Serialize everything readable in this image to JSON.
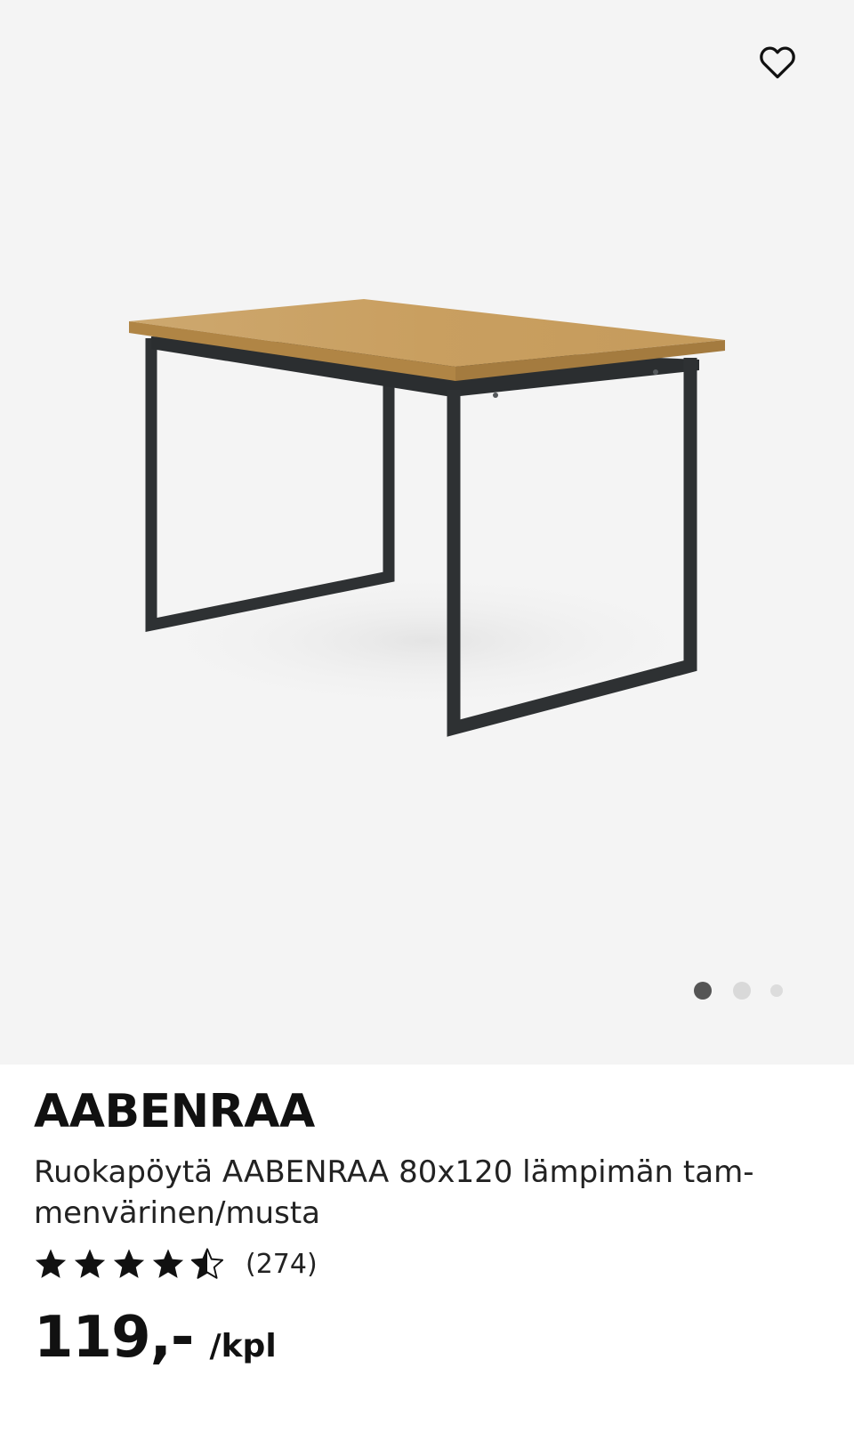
{
  "product": {
    "brand": "AABENRAA",
    "description": "Ruokapöytä AABENRAA 80x120 lämpimän tam-menvärinen/musta",
    "rating": {
      "value": 4.5,
      "max": 5,
      "count": "(274)"
    },
    "price": "119,-",
    "unit": "/kpl"
  },
  "gallery": {
    "image_subject": "dining-table",
    "current_index": 1,
    "total_images": 3
  },
  "icons": {
    "favorite": "heart-outline-icon",
    "star": "star-icon"
  },
  "colors": {
    "gallery_background": "#f4f4f4",
    "active_dot": "#555555",
    "inactive_dot": "#d9d9d9",
    "text": "#111111",
    "table_top": "#c9a56a",
    "table_frame": "#2e3133"
  }
}
